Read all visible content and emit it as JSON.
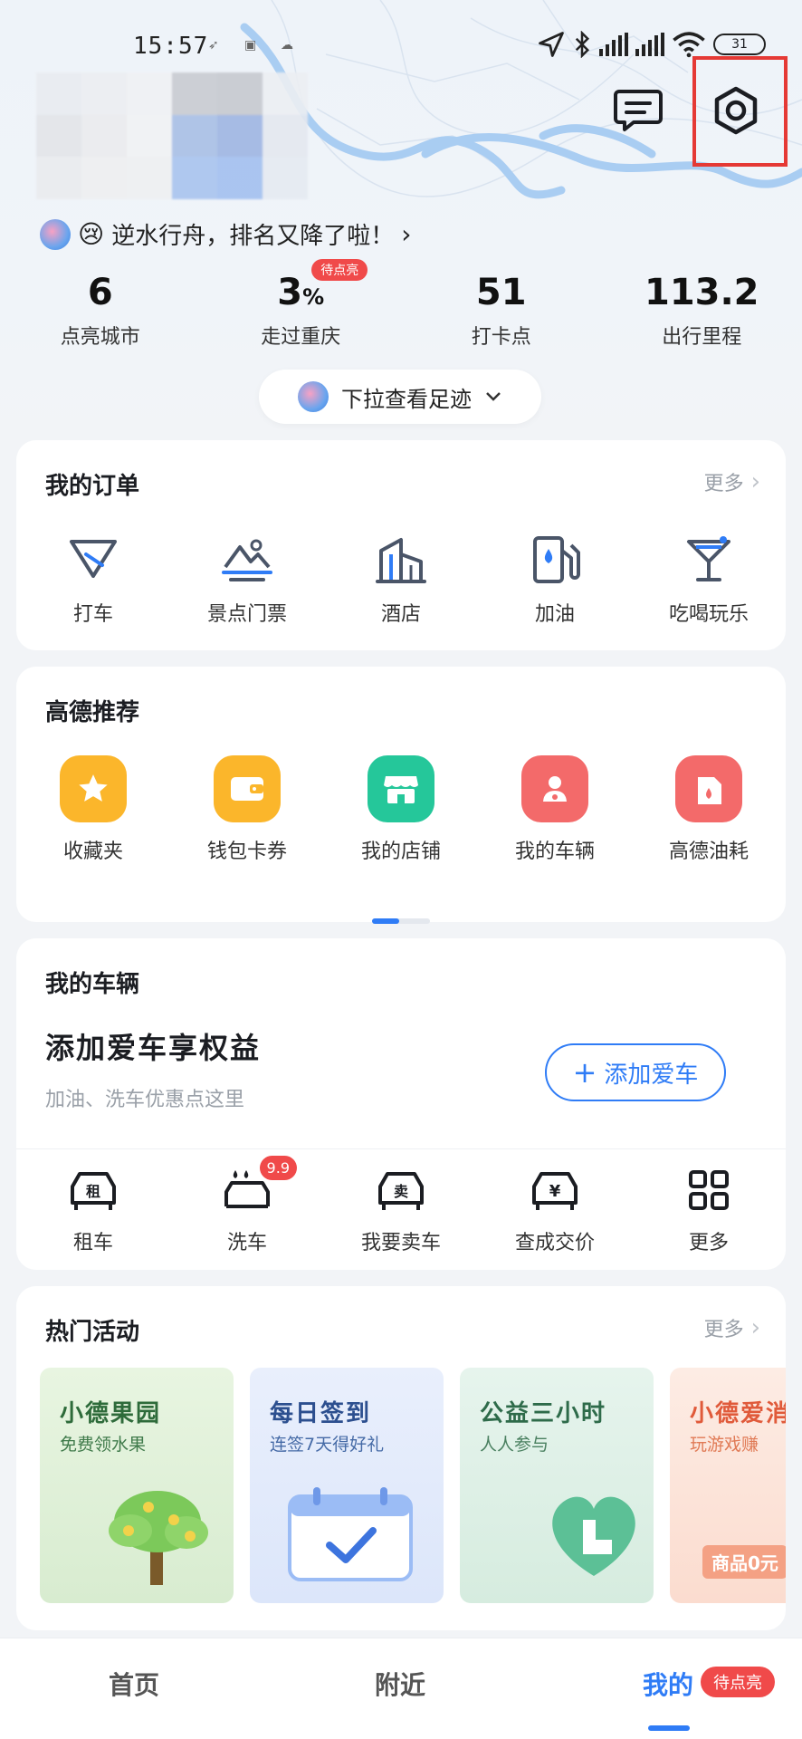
{
  "status_bar": {
    "time": "15:57",
    "battery": "31"
  },
  "header": {
    "rank_text": "逆水行舟，排名又降了啦！"
  },
  "stats": [
    {
      "value": "6",
      "unit": "",
      "label": "点亮城市"
    },
    {
      "value": "3",
      "unit": "%",
      "label": "走过重庆",
      "badge": "待点亮"
    },
    {
      "value": "51",
      "unit": "",
      "label": "打卡点"
    },
    {
      "value": "113.2",
      "unit": "",
      "label": "出行里程"
    }
  ],
  "pull_hint": "下拉查看足迹",
  "orders": {
    "title": "我的订单",
    "more": "更多",
    "items": [
      {
        "label": "打车",
        "icon": "taxi-icon"
      },
      {
        "label": "景点门票",
        "icon": "scenic-ticket-icon"
      },
      {
        "label": "酒店",
        "icon": "hotel-icon"
      },
      {
        "label": "加油",
        "icon": "fuel-icon"
      },
      {
        "label": "吃喝玩乐",
        "icon": "cocktail-icon"
      }
    ]
  },
  "recommend": {
    "title": "高德推荐",
    "items": [
      {
        "label": "收藏夹",
        "icon": "star-icon",
        "color": "#fbb62b"
      },
      {
        "label": "钱包卡券",
        "icon": "wallet-icon",
        "color": "#fbb62b"
      },
      {
        "label": "我的店铺",
        "icon": "store-icon",
        "color": "#25c79a"
      },
      {
        "label": "我的车辆",
        "icon": "driver-icon",
        "color": "#f36a6a"
      },
      {
        "label": "高德油耗",
        "icon": "fuel-can-icon",
        "color": "#f36a6a"
      }
    ]
  },
  "vehicles": {
    "title": "我的车辆",
    "promo": "添加爱车享权益",
    "sub": "加油、洗车优惠点这里",
    "add_button": "添加爱车",
    "items": [
      {
        "label": "租车",
        "icon": "rent-car-icon"
      },
      {
        "label": "洗车",
        "icon": "car-wash-icon",
        "badge": "9.9"
      },
      {
        "label": "我要卖车",
        "icon": "sell-car-icon"
      },
      {
        "label": "查成交价",
        "icon": "car-price-icon"
      },
      {
        "label": "更多",
        "icon": "grid-icon"
      }
    ]
  },
  "activities": {
    "title": "热门活动",
    "more": "更多",
    "cards": [
      {
        "title": "小德果园",
        "sub": "免费领水果",
        "title_color": "#2e6b3a",
        "bg": "#e3f3dc"
      },
      {
        "title": "每日签到",
        "sub": "连签7天得好礼",
        "title_color": "#2c4f8f",
        "bg": "#e5ecfb"
      },
      {
        "title": "公益三小时",
        "sub": "人人参与",
        "title_color": "#2e6b4a",
        "bg": "#e2f2ea"
      },
      {
        "title": "小德爱消",
        "sub": "玩游戏赚",
        "title_color": "#e05a3a",
        "bg": "#fde9e0",
        "extra": "商品0元"
      }
    ]
  },
  "tabbar": {
    "tabs": [
      {
        "label": "首页"
      },
      {
        "label": "附近"
      },
      {
        "label": "我的"
      }
    ],
    "badge": "待点亮"
  },
  "colors": {
    "accent": "#2f7cf6",
    "badge_red": "#f04a4a"
  }
}
